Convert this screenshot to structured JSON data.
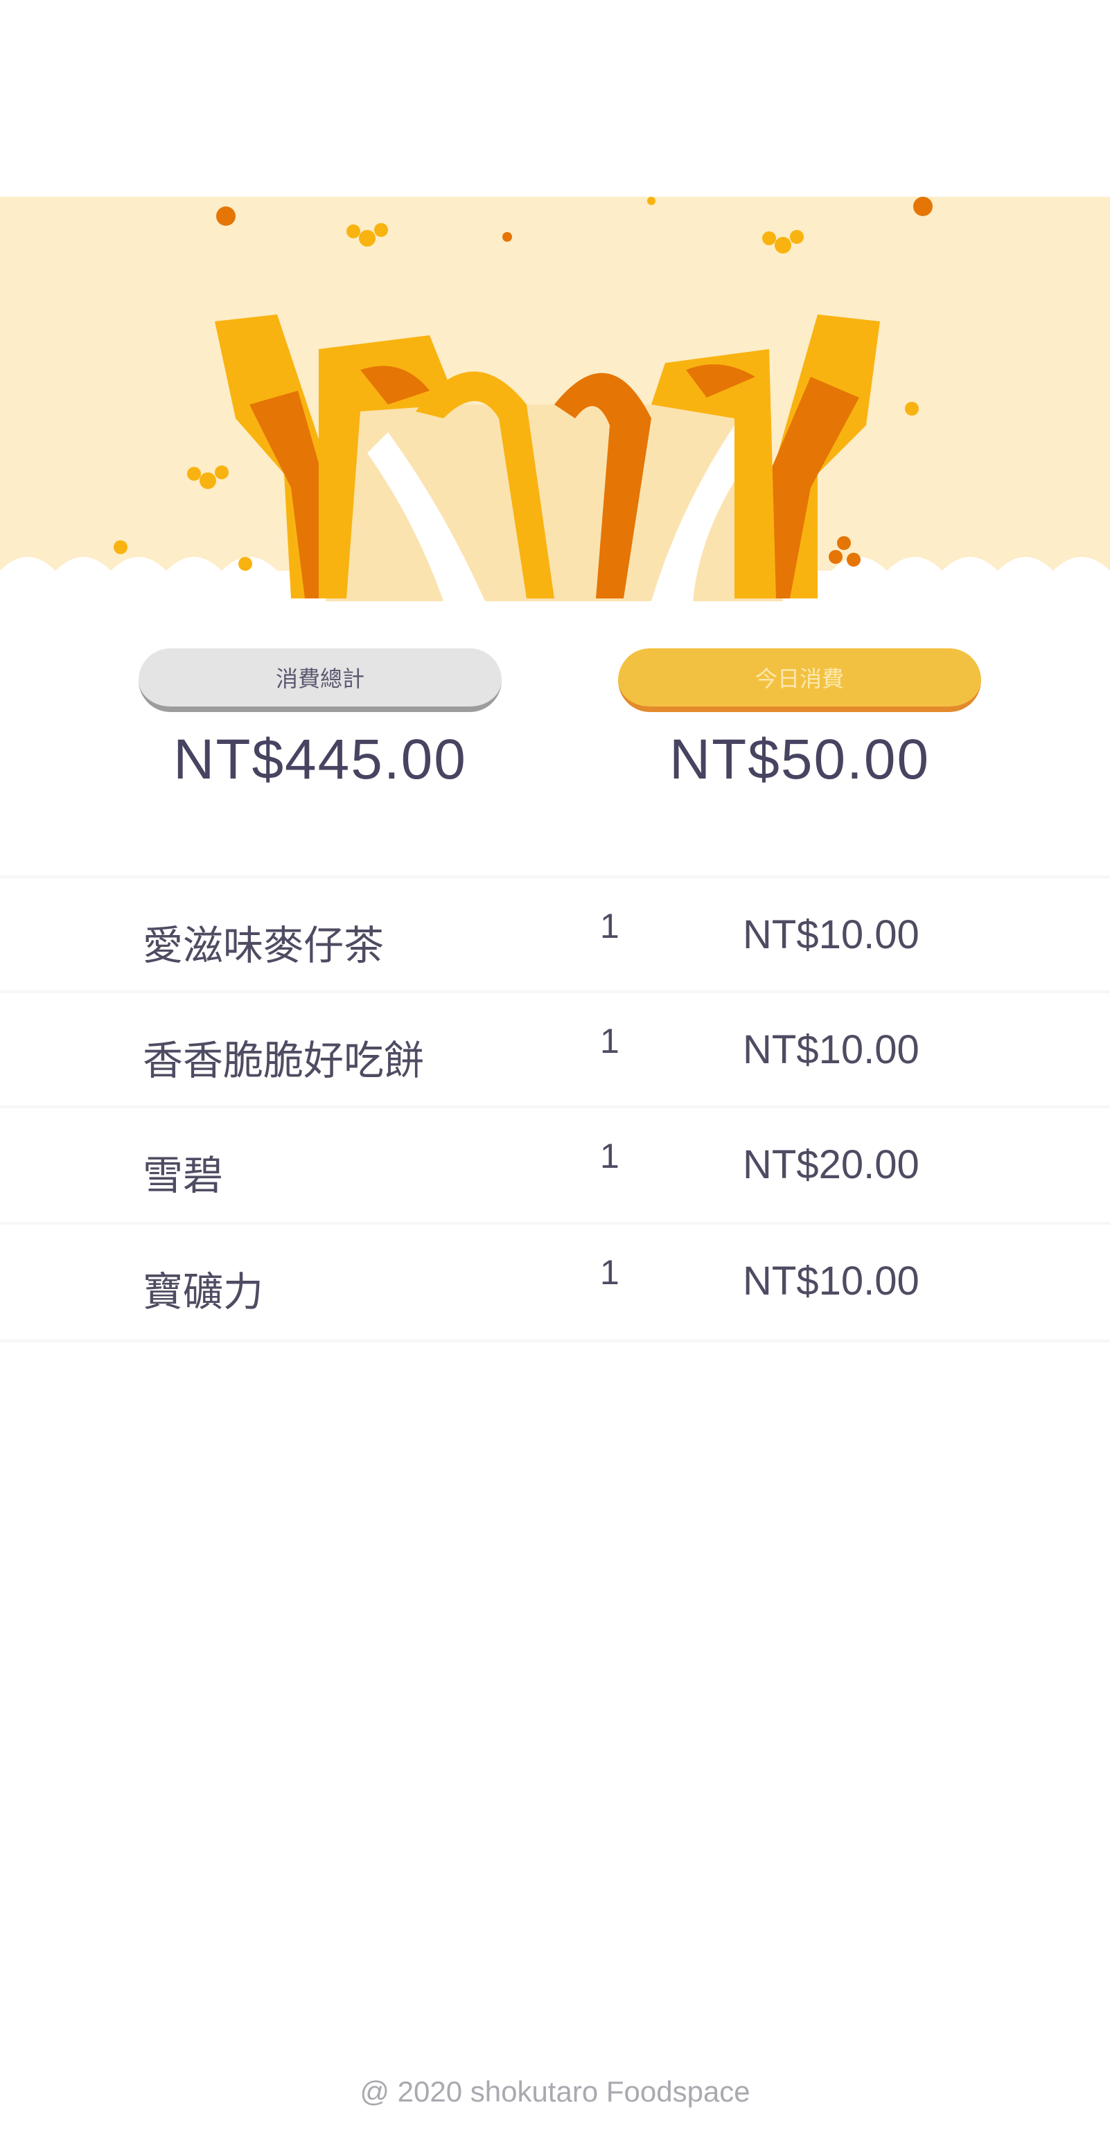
{
  "summary": {
    "total_label": "消費總計",
    "total_amount": "NT$445.00",
    "today_label": "今日消費",
    "today_amount": "NT$50.00"
  },
  "items": [
    {
      "name": "愛滋味麥仔茶",
      "qty": "1",
      "price": "NT$10.00"
    },
    {
      "name": "香香脆脆好吃餅",
      "qty": "1",
      "price": "NT$10.00"
    },
    {
      "name": "雪碧",
      "qty": "1",
      "price": "NT$20.00"
    },
    {
      "name": "寶礦力",
      "qty": "1",
      "price": "NT$10.00"
    }
  ],
  "footer": "@ 2020 shokutaro Foodspace",
  "colors": {
    "banner": "#fdedc8",
    "accent": "#f3c141",
    "orange": "#e37a10"
  }
}
